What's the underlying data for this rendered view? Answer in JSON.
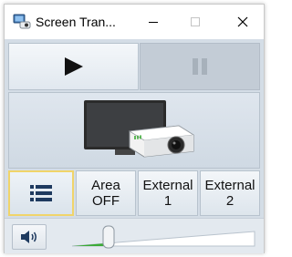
{
  "window": {
    "title": "Screen Tran...",
    "app_icon": "screen-transfer-app-icon",
    "controls": {
      "minimize": "minimize-icon",
      "maximize": "maximize-icon",
      "close": "close-icon"
    }
  },
  "transport": {
    "play_icon": "play-icon",
    "pause_icon": "pause-icon"
  },
  "device_panel": {
    "icon": "display-and-projector-icon"
  },
  "modes": [
    {
      "label_line1": "",
      "label_line2": "",
      "icon": "list-icon",
      "selected": true
    },
    {
      "label_line1": "Area",
      "label_line2": "OFF",
      "selected": false
    },
    {
      "label_line1": "External",
      "label_line2": "1",
      "selected": false
    },
    {
      "label_line1": "External",
      "label_line2": "2",
      "selected": false
    }
  ],
  "volume": {
    "icon": "speaker-icon",
    "level_fraction": 0.2
  },
  "colors": {
    "accent_green": "#3aaa35",
    "selected_border": "#f0d46a",
    "panel_bg": "#d4dde6"
  }
}
